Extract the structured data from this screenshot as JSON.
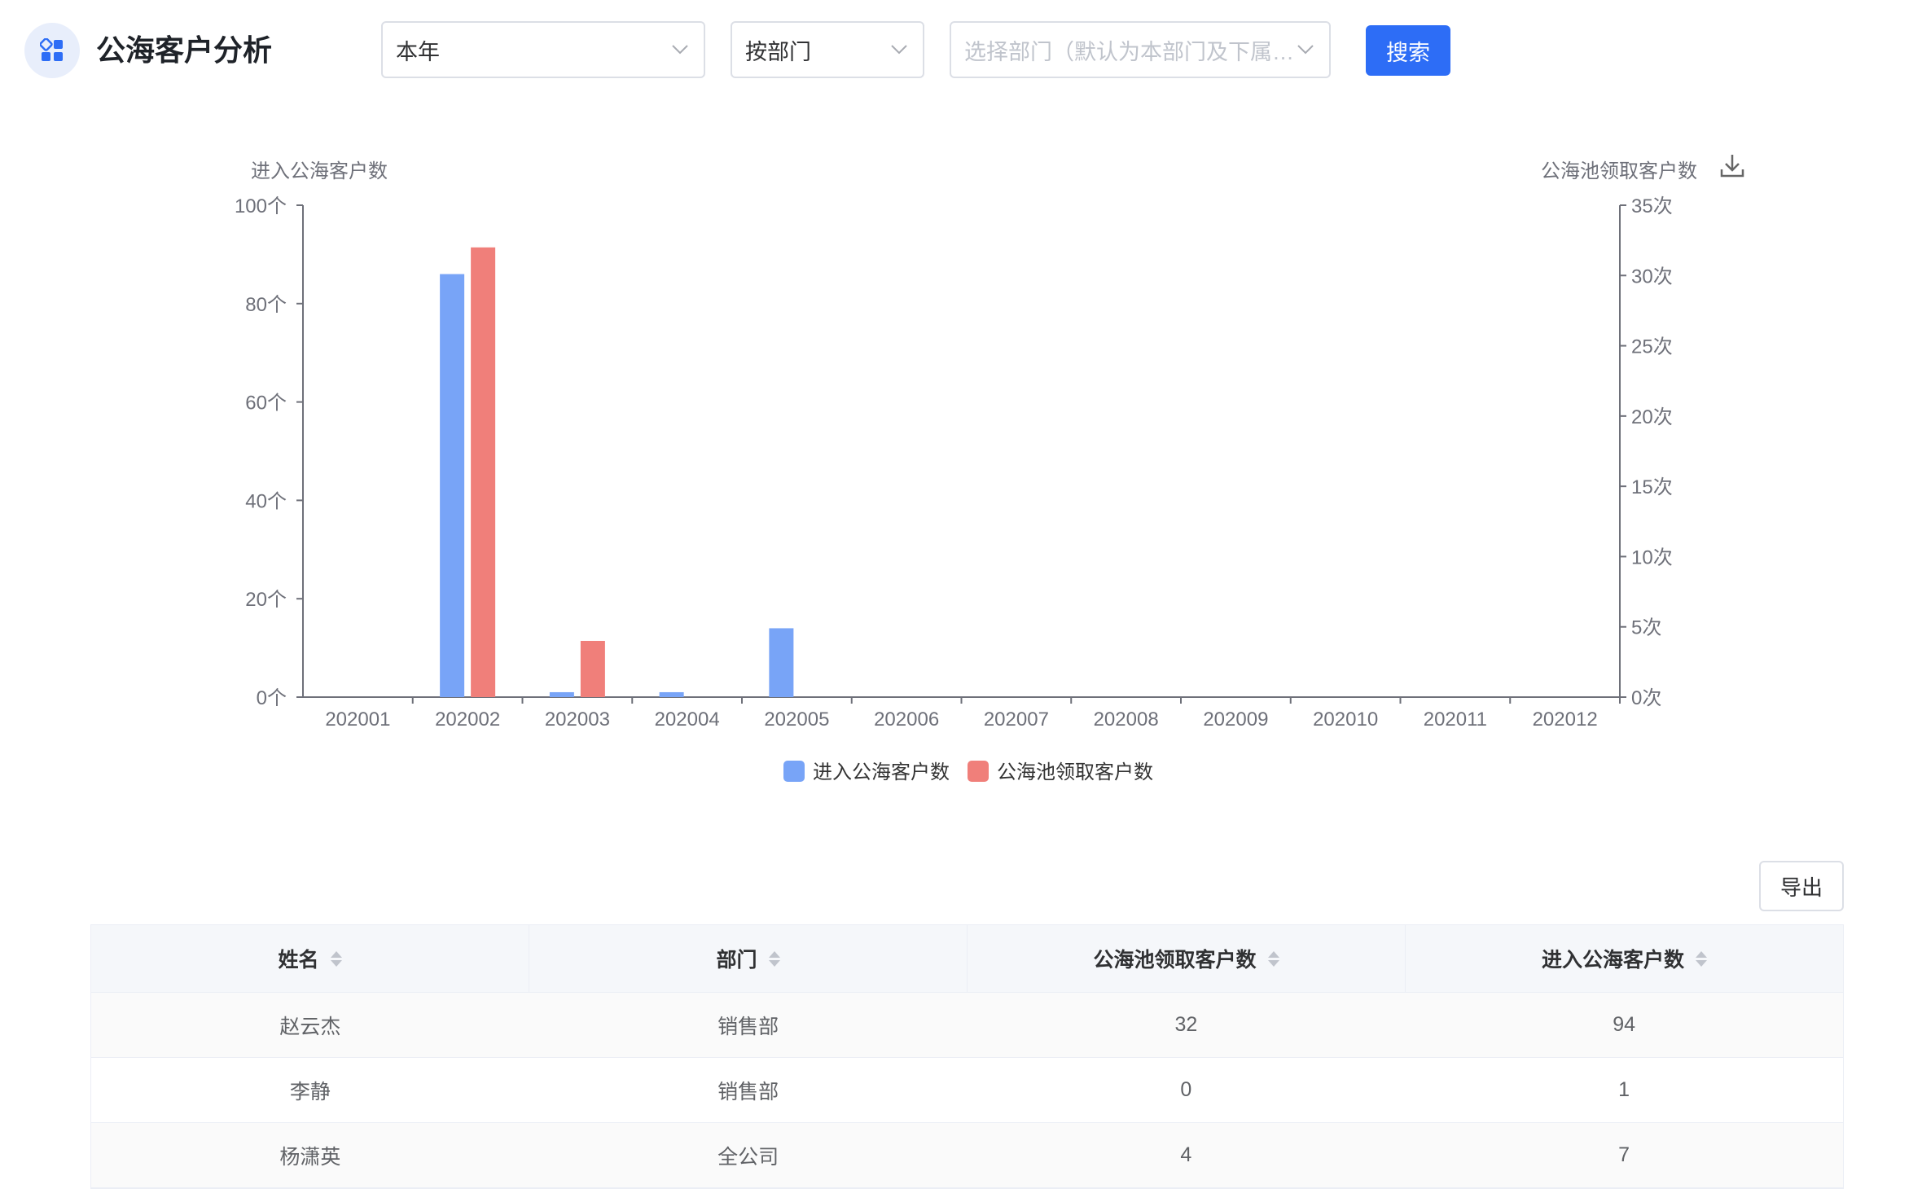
{
  "header": {
    "title": "公海客户分析",
    "period_select": {
      "value": "本年"
    },
    "group_select": {
      "value": "按部门"
    },
    "dept_select": {
      "placeholder": "选择部门（默认为本部门及下属部..."
    },
    "search_label": "搜索"
  },
  "colors": {
    "primary": "#2d6df6",
    "series1": "#78a4f7",
    "series2": "#f07f7a"
  },
  "icons": {
    "app": "grid-icon",
    "download": "download-icon",
    "chevron": "chevron-down-icon",
    "sort": "sort-icon"
  },
  "chart_data": {
    "type": "bar",
    "categories": [
      "202001",
      "202002",
      "202003",
      "202004",
      "202005",
      "202006",
      "202007",
      "202008",
      "202009",
      "202010",
      "202011",
      "202012"
    ],
    "series": [
      {
        "name": "进入公海客户数",
        "axis": "left",
        "values": [
          0,
          86,
          1,
          1,
          14,
          0,
          0,
          0,
          0,
          0,
          0,
          0
        ]
      },
      {
        "name": "公海池领取客户数",
        "axis": "right",
        "values": [
          0,
          32,
          4,
          0,
          0,
          0,
          0,
          0,
          0,
          0,
          0,
          0
        ]
      }
    ],
    "ylabel_left": "进入公海客户数",
    "ylabel_right": "公海池领取客户数",
    "ylim_left": [
      0,
      100
    ],
    "ylim_right": [
      0,
      35
    ],
    "yticks_left": [
      "0个",
      "20个",
      "40个",
      "60个",
      "80个",
      "100个"
    ],
    "yticks_right": [
      "0次",
      "5次",
      "10次",
      "15次",
      "20次",
      "25次",
      "30次",
      "35次"
    ],
    "legend_position": "bottom-center",
    "grid": false
  },
  "export_label": "导出",
  "table": {
    "columns": [
      "姓名",
      "部门",
      "公海池领取客户数",
      "进入公海客户数"
    ],
    "rows": [
      [
        "赵云杰",
        "销售部",
        "32",
        "94"
      ],
      [
        "李静",
        "销售部",
        "0",
        "1"
      ],
      [
        "杨潇英",
        "全公司",
        "4",
        "7"
      ]
    ]
  }
}
